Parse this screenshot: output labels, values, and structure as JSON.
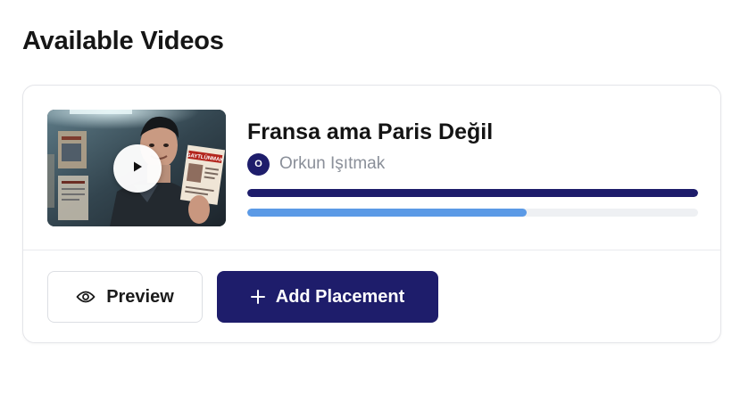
{
  "page": {
    "title": "Available Videos"
  },
  "video": {
    "title": "Fransa ama Paris Değil",
    "author": {
      "name": "Orkun Işıtmak",
      "initial": "O"
    },
    "thumbnail": {
      "sign_text": "GAYTLÜNMAK"
    },
    "progress_bars": [
      {
        "value": 1.0,
        "color": "#1e1d6b"
      },
      {
        "value": 0.62,
        "color": "#5b9ae6"
      }
    ]
  },
  "actions": {
    "preview_label": "Preview",
    "add_placement_label": "Add Placement"
  },
  "icons": {
    "play": "play-icon",
    "preview": "eye-icon",
    "add": "plus-icon"
  },
  "colors": {
    "accent": "#1e1d6b",
    "secondary_bar": "#5b9ae6",
    "muted_text": "#8a8f99"
  }
}
